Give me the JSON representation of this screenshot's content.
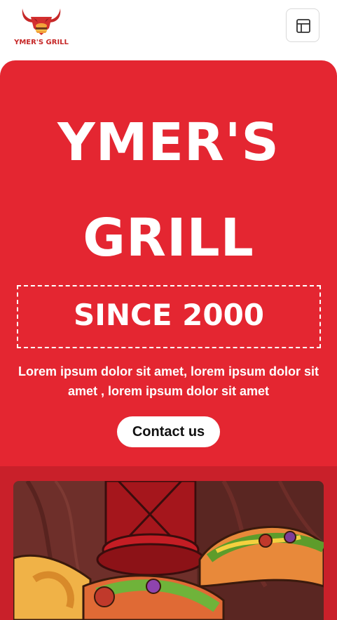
{
  "brand": {
    "logo_text": "YMER'S GRILL",
    "logo_icon": "bull-burger-logo"
  },
  "header": {
    "menu_icon": "layout-icon"
  },
  "hero": {
    "title_line1": "YMER'S",
    "title_line2": "GRILL",
    "since": "SINCE 2000",
    "tagline": "Lorem ipsum dolor sit amet, lorem ipsum dolor sit amet , lorem ipsum dolor sit amet",
    "cta_label": "Contact us"
  },
  "colors": {
    "primary": "#e42631",
    "band": "#c9202a",
    "white": "#ffffff"
  },
  "image": {
    "subject": "illustrated grilled food with hot dogs and burger on wooden board"
  }
}
